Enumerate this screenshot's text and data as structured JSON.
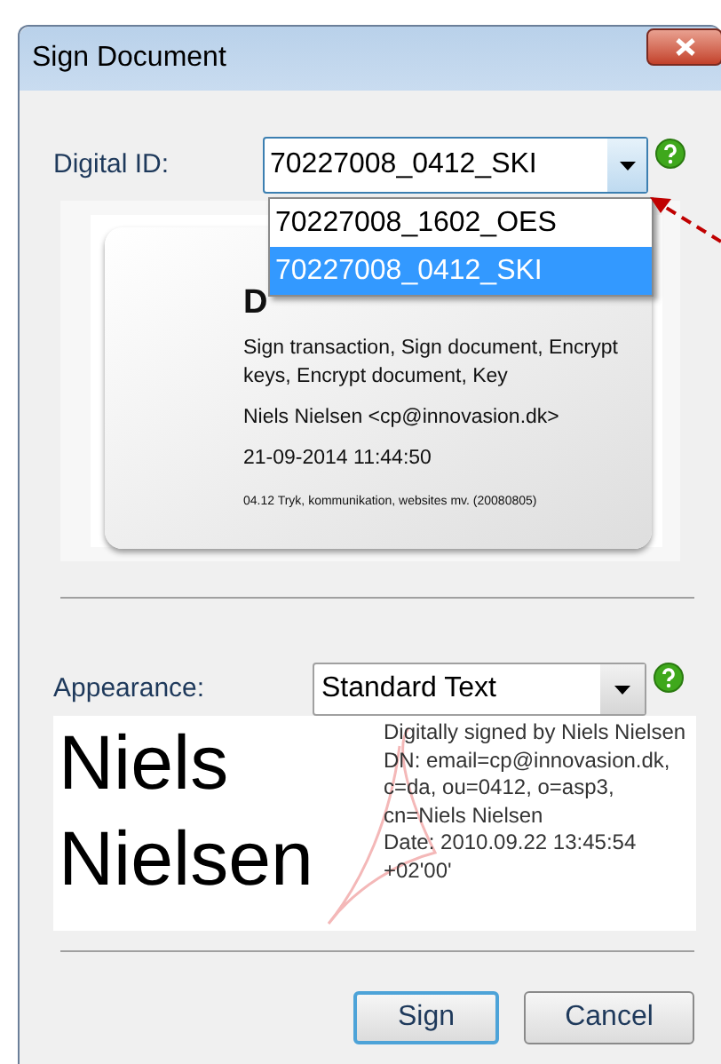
{
  "window": {
    "title": "Sign Document"
  },
  "digital_id": {
    "label": "Digital ID:",
    "value": "70227008_0412_SKI",
    "expanded": true,
    "options": [
      {
        "label": "70227008_1602_OES",
        "selected": false
      },
      {
        "label": "70227008_0412_SKI",
        "selected": true
      }
    ]
  },
  "id_card": {
    "title": "D",
    "lines": [
      "Sign transaction, Sign document, Encrypt keys, Encrypt document, Key",
      "Niels Nielsen <cp@innovasion.dk>",
      "21-09-2014 11:44:50"
    ],
    "footnote": "04.12 Tryk, kommunikation, websites mv.  (20080805)"
  },
  "appearance": {
    "label": "Appearance:",
    "value": "Standard Text"
  },
  "signature_preview": {
    "name_lines": [
      "Niels",
      "Nielsen"
    ],
    "details": [
      "Digitally signed by Niels Nielsen",
      "DN: email=cp@innovasion.dk, c=da, ou=0412, o=asp3, cn=Niels Nielsen",
      "Date: 2010.09.22 13:45:54 +02'00'"
    ]
  },
  "buttons": [
    {
      "label": "Sign",
      "default": true
    },
    {
      "label": "Cancel",
      "default": false
    }
  ]
}
